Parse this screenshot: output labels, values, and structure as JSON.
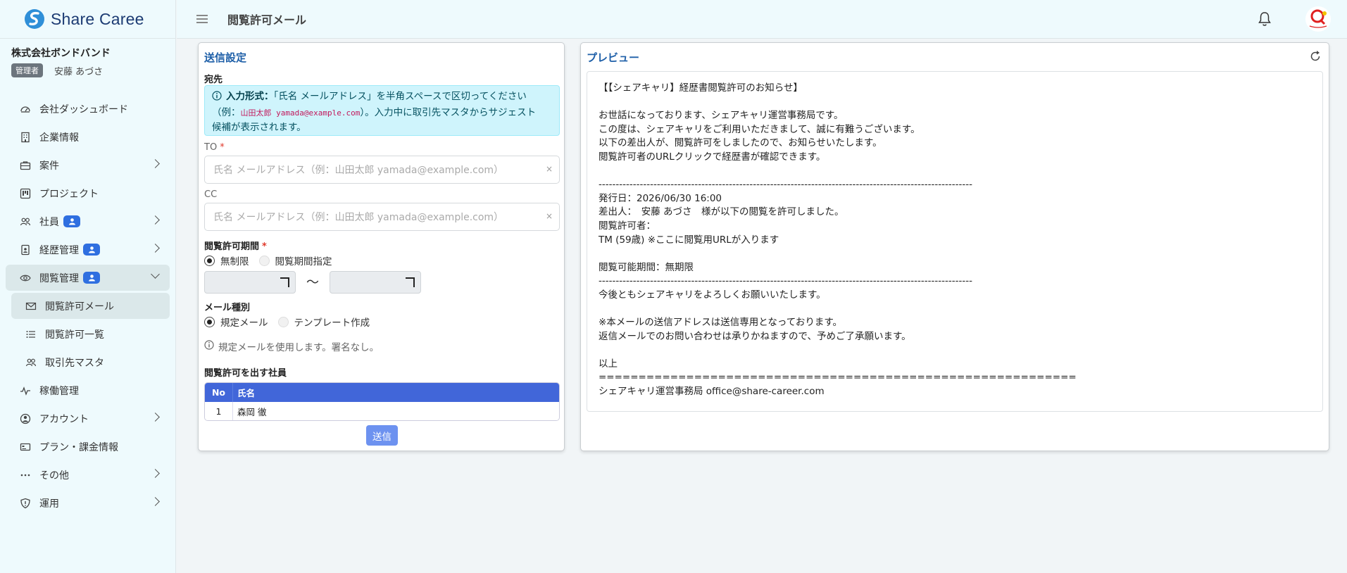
{
  "brand": {
    "name": "Share Caree"
  },
  "company": {
    "name": "株式会社ボンドバンド",
    "role": "管理者",
    "user": "安藤 あづさ"
  },
  "sidebar": {
    "items": [
      {
        "label": "会社ダッシュボード"
      },
      {
        "label": "企業情報"
      },
      {
        "label": "案件"
      },
      {
        "label": "プロジェクト"
      },
      {
        "label": "社員"
      },
      {
        "label": "経歴管理"
      },
      {
        "label": "閲覧管理"
      },
      {
        "label": "閲覧許可メール"
      },
      {
        "label": "閲覧許可一覧"
      },
      {
        "label": "取引先マスタ"
      },
      {
        "label": "稼働管理"
      },
      {
        "label": "アカウント"
      },
      {
        "label": "プラン・課金情報"
      },
      {
        "label": "その他"
      },
      {
        "label": "運用"
      }
    ]
  },
  "header": {
    "title": "閲覧許可メール"
  },
  "send_settings": {
    "title": "送信設定",
    "recipient_label": "宛先",
    "info_bold": "入力形式：",
    "info_text1": "「氏名 メールアドレス」を半角スペースで区切ってください",
    "info_text2a": "（例：",
    "info_example": "山田太郎 yamada@example.com",
    "info_text2b": "）。入力中に取引先マスタからサジェスト",
    "info_text3": "候補が表示されます。",
    "to_label": "TO",
    "to_placeholder": "氏名 メールアドレス（例：山田太郎 yamada@example.com）",
    "cc_label": "CC",
    "cc_placeholder": "氏名 メールアドレス（例：山田太郎 yamada@example.com）",
    "clear": "×",
    "required": "*",
    "period_label": "閲覧許可期間",
    "period_unlimited": "無制限",
    "period_specified": "閲覧期間指定",
    "tilde": "〜",
    "mail_type_label": "メール種別",
    "mail_standard": "規定メール",
    "mail_template": "テンプレート作成",
    "hint": "規定メールを使用します。署名なし。",
    "employees_label": "閲覧許可を出す社員",
    "table_headers": [
      "No",
      "氏名"
    ],
    "table_rows": [
      {
        "no": "1",
        "name": "森岡 徹"
      }
    ],
    "send_button": "送信"
  },
  "preview": {
    "title": "プレビュー",
    "lines": [
      "【【シェアキャリ】経歴書閲覧許可のお知らせ】",
      "",
      "お世話になっております、シェアキャリ運営事務局です。",
      "この度は、シェアキャリをご利用いただきまして、誠に有難うございます。",
      "以下の差出人が、閲覧許可をしましたので、お知らせいたします。",
      "閲覧許可者のURLクリックで経歴書が確認できます。",
      "",
      "-------------------------------------------------------------------------------------------------------------",
      "発行日：2026/06/30 16:00",
      "差出人：　安藤 あづさ　様が以下の閲覧を許可しました。",
      "閲覧許可者：",
      "TM (59歳) ※ここに閲覧用URLが入ります",
      "",
      "閲覧可能期間：無期限",
      "-------------------------------------------------------------------------------------------------------------",
      "今後ともシェアキャリをよろしくお願いいたします。",
      "",
      "※本メールの送信アドレスは送信専用となっております。",
      "返信メールでのお問い合わせは承りかねますので、予めご了承願います。",
      "",
      "以上",
      "============================================================",
      "シェアキャリ運営事務局 office@share-career.com"
    ]
  }
}
